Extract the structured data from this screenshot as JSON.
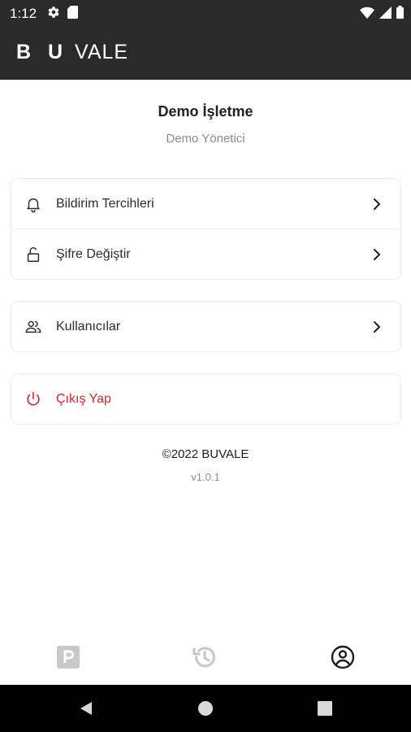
{
  "status_bar": {
    "time": "1:12",
    "left_icons": [
      "settings-icon",
      "sd-card-icon"
    ],
    "right_icons": [
      "wifi-icon",
      "signal-icon",
      "battery-icon"
    ]
  },
  "app_bar": {
    "logo_bold": "B U",
    "logo_light": "VALE"
  },
  "profile": {
    "name": "Demo İşletme",
    "role": "Demo Yönetici"
  },
  "menu": {
    "group1": [
      {
        "label": "Bildirim Tercihleri",
        "icon": "bell-icon"
      },
      {
        "label": "Şifre Değiştir",
        "icon": "unlock-icon"
      }
    ],
    "group2": [
      {
        "label": "Kullanıcılar",
        "icon": "users-icon"
      }
    ],
    "logout": {
      "label": "Çıkış Yap",
      "icon": "power-icon"
    }
  },
  "footer": {
    "copyright": "©2022 BUVALE",
    "version": "v1.0.1"
  },
  "bottom_nav": {
    "items": [
      {
        "icon": "parking-icon",
        "active": false
      },
      {
        "icon": "history-icon",
        "active": false
      },
      {
        "icon": "profile-icon",
        "active": true
      }
    ]
  },
  "colors": {
    "header_bg": "#2a2a2a",
    "danger": "#d6262e",
    "inactive_icon": "#c9c9c9",
    "active_icon": "#1e1e1e"
  }
}
